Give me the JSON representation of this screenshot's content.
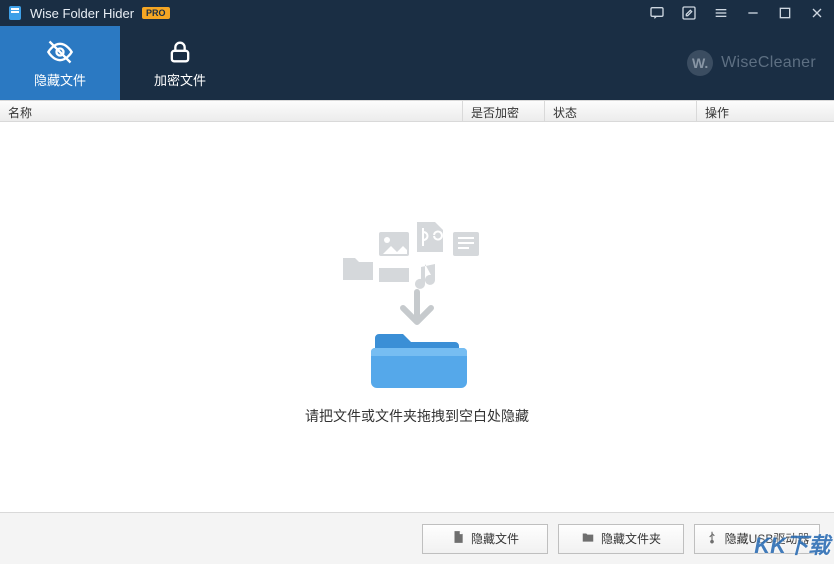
{
  "app": {
    "title": "Wise Folder Hider",
    "badge": "PRO",
    "brand": "WiseCleaner",
    "brand_initial": "W."
  },
  "tabs": {
    "hide": "隐藏文件",
    "encrypt": "加密文件"
  },
  "columns": {
    "name": "名称",
    "encrypted": "是否加密",
    "status": "状态",
    "ops": "操作"
  },
  "drop": {
    "hint": "请把文件或文件夹拖拽到空白处隐藏"
  },
  "buttons": {
    "hide_file": "隐藏文件",
    "hide_folder": "隐藏文件夹",
    "hide_usb": "隐藏USB驱动器"
  },
  "watermark": "KK下载"
}
